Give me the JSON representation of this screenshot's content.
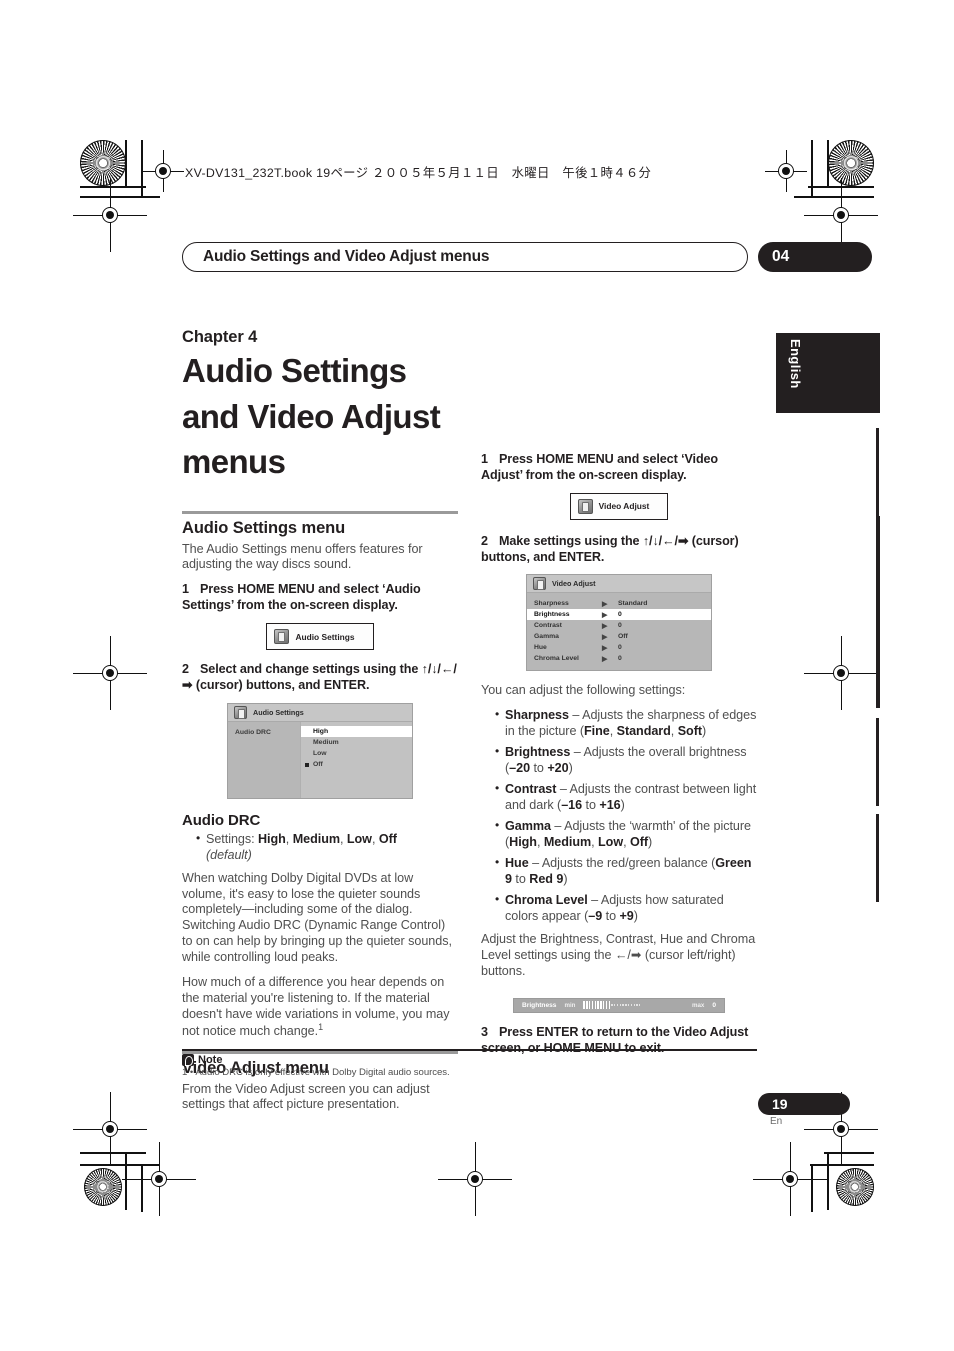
{
  "printmarks": {
    "filename_line": "XV-DV131_232T.book  19ページ  ２００５年５月１１日　水曜日　午後１時４６分"
  },
  "header": {
    "running_title": "Audio Settings and Video Adjust menus",
    "chapter_badge": "04",
    "language_tab": "English"
  },
  "left_column": {
    "chapter_label": "Chapter 4",
    "chapter_title": "Audio Settings and Video Adjust menus",
    "section1": {
      "heading": "Audio Settings menu",
      "intro": "The Audio Settings menu offers features for adjusting the way discs sound.",
      "step1_num": "1",
      "step1_text": "Press HOME MENU and select ‘Audio Settings’ from the on-screen display.",
      "osd_button_label": "Audio Settings",
      "step2_num": "2",
      "step2_text": "Select and change settings using the ↑/↓/←/➡ (cursor) buttons, and ENTER.",
      "osd_panel": {
        "title": "Audio Settings",
        "items": [
          "Audio DRC"
        ],
        "options": [
          "High",
          "Medium",
          "Low",
          "Off"
        ],
        "highlighted_option": "High",
        "marked_option": "Off"
      }
    },
    "audio_drc": {
      "heading": "Audio DRC",
      "settings_bullet_prefix": "Settings: ",
      "settings_values": [
        "High",
        "Medium",
        "Low",
        "Off"
      ],
      "settings_default": "(default)",
      "para1": "When watching Dolby Digital DVDs at low volume, it's easy to lose the quieter sounds completely—including some of the dialog. Switching Audio DRC (Dynamic Range Control) to on can help by bringing up the quieter sounds, while controlling loud peaks.",
      "para2": "How much of a difference you hear depends on the material you're listening to. If the material doesn't have wide variations in volume, you may not notice much change.",
      "para2_footnote_marker": "1"
    },
    "section2": {
      "heading": "Video Adjust menu",
      "intro": "From the Video Adjust screen you can adjust settings that affect picture presentation."
    }
  },
  "right_column": {
    "step1_num": "1",
    "step1_text": "Press HOME MENU and select ‘Video Adjust’ from the on-screen display.",
    "osd_button_label": "Video Adjust",
    "step2_num": "2",
    "step2_text": "Make settings using the ↑/↓/←/➡ (cursor) buttons, and ENTER.",
    "osd_panel": {
      "title": "Video Adjust",
      "rows": [
        {
          "label": "Sharpness",
          "arrow": "▶",
          "value": "Standard",
          "highlighted": false
        },
        {
          "label": "Brightness",
          "arrow": "▶",
          "value": "0",
          "highlighted": true
        },
        {
          "label": "Contrast",
          "arrow": "▶",
          "value": "0",
          "highlighted": false
        },
        {
          "label": "Gamma",
          "arrow": "▶",
          "value": "Off",
          "highlighted": false
        },
        {
          "label": "Hue",
          "arrow": "▶",
          "value": "0",
          "highlighted": false
        },
        {
          "label": "Chroma Level",
          "arrow": "▶",
          "value": "0",
          "highlighted": false
        }
      ]
    },
    "settings_intro": "You can adjust the following settings:",
    "settings": [
      {
        "name": "Sharpness",
        "desc": " – Adjusts the sharpness of edges in the picture (",
        "values": [
          "Fine",
          "Standard",
          "Soft"
        ],
        "sep": ", ",
        "close": ")"
      },
      {
        "name": "Brightness",
        "desc": "  – Adjusts the overall brightness (",
        "values": [
          "–20",
          "+20"
        ],
        "sep": " to ",
        "close": ")"
      },
      {
        "name": "Contrast",
        "desc": " – Adjusts the contrast between light and dark (",
        "values": [
          "–16",
          "+16"
        ],
        "sep": " to ",
        "close": ")"
      },
      {
        "name": "Gamma",
        "desc": " – Adjusts the ‘warmth' of the picture (",
        "values": [
          "High",
          "Medium",
          "Low",
          "Off"
        ],
        "sep": ", ",
        "close": ")"
      },
      {
        "name": "Hue",
        "desc": " – Adjusts the red/green balance (",
        "values": [
          "Green 9",
          "Red 9"
        ],
        "sep": " to ",
        "close": ")"
      },
      {
        "name": "Chroma Level",
        "desc": "  – Adjusts how saturated colors appear (",
        "values": [
          "–9",
          "+9"
        ],
        "sep": " to ",
        "close": ")"
      }
    ],
    "adjust_note": "Adjust the Brightness, Contrast, Hue and Chroma Level settings using the ←/➡ (cursor left/right) buttons.",
    "slider": {
      "label": "Brightness",
      "min_label": "min",
      "max_label": "max",
      "value": "0",
      "ticks_on": 10,
      "ticks_off": 11
    },
    "step3_num": "3",
    "step3_text": "Press ENTER to return to the Video Adjust screen, or HOME MENU to exit."
  },
  "note": {
    "heading": "Note",
    "marker": "1",
    "text": "• Audio DRC is only effective with Dolby Digital audio sources."
  },
  "footer": {
    "page_number": "19",
    "page_lang": "En"
  }
}
